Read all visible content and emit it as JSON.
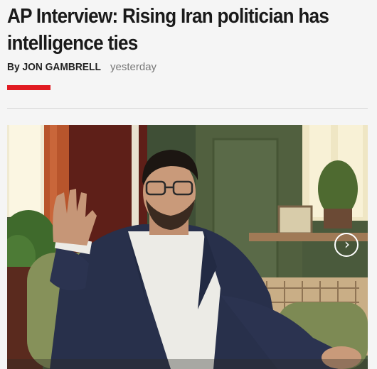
{
  "article": {
    "headline": "AP Interview: Rising Iran politician has intelligence ties",
    "byline": "By JON GAMBRELL",
    "timestamp": "yesterday"
  },
  "gallery": {
    "next_icon": "chevron-right-icon"
  },
  "colors": {
    "accent_red": "#e11b22",
    "headline": "#1a1a1a",
    "timestamp": "#777777",
    "background": "#f5f5f5"
  }
}
